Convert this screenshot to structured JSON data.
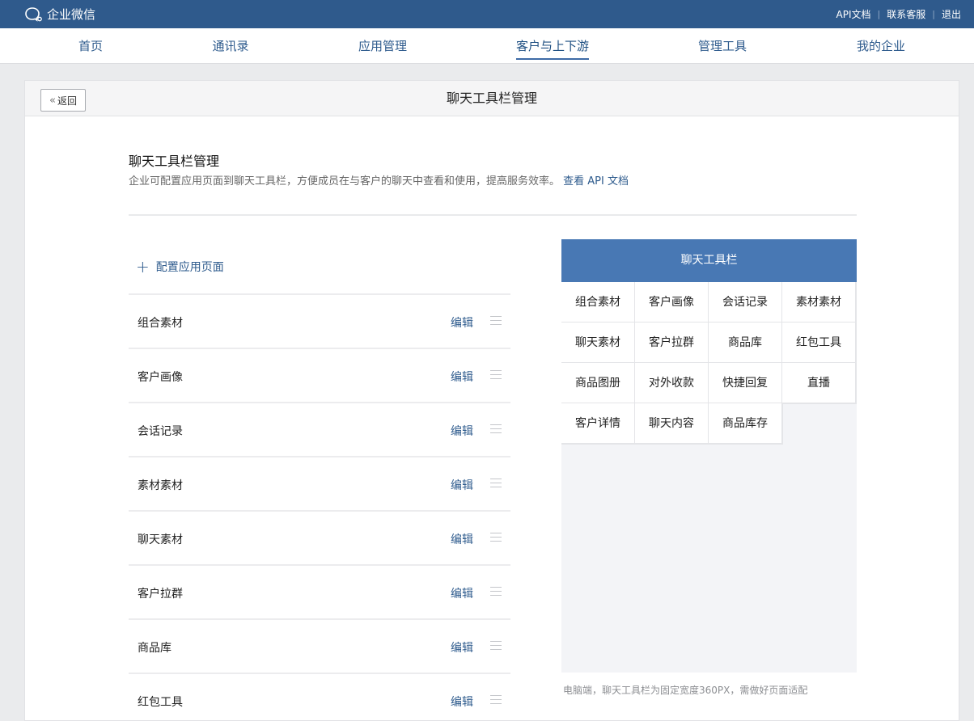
{
  "topbar": {
    "brand": "企业微信",
    "links": [
      "API文档",
      "联系客服",
      "退出"
    ],
    "brand_color": "#2f5a8c"
  },
  "nav": {
    "tabs": [
      {
        "label": "首页",
        "icon": ""
      },
      {
        "label": "通讯录"
      },
      {
        "label": "应用管理"
      },
      {
        "label": "客户与上下游"
      },
      {
        "label": "管理工具"
      },
      {
        "label": "我的企业"
      }
    ],
    "active_index": 3
  },
  "page": {
    "back_label": "返回",
    "header_title": "聊天工具栏管理",
    "section_title": "聊天工具栏管理",
    "section_desc": "企业可配置应用页面到聊天工具栏，方便成员在与客户的聊天中查看和使用，提高服务效率。",
    "api_link": "查看 API 文档",
    "add_page_label": "配置应用页面",
    "edit_label": "编辑"
  },
  "tool_list": [
    "组合素材",
    "客户画像",
    "会话记录",
    "素材素材",
    "聊天素材",
    "客户拉群",
    "商品库",
    "红包工具"
  ],
  "preview": {
    "header": "聊天工具栏",
    "accent": "#4878b4",
    "cells": [
      "组合素材",
      "客户画像",
      "会话记录",
      "素材素材",
      "聊天素材",
      "客户拉群",
      "商品库",
      "红包工具",
      "商品图册",
      "对外收款",
      "快捷回复",
      "直播",
      "客户详情",
      "聊天内容",
      "商品库存"
    ],
    "note": "电脑端，聊天工具栏为固定宽度360PX，需做好页面适配"
  }
}
